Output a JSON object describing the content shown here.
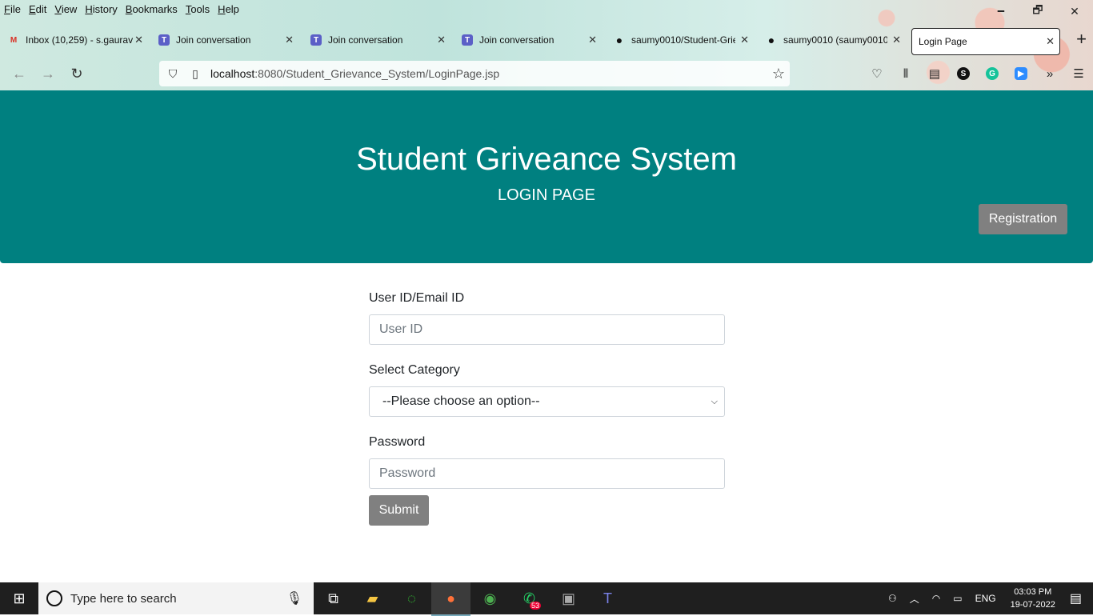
{
  "browser": {
    "menu": [
      "File",
      "Edit",
      "View",
      "History",
      "Bookmarks",
      "Tools",
      "Help"
    ],
    "window_controls": {
      "minimize": "🗕",
      "restore": "🗗",
      "close": "✕"
    },
    "tabs": [
      {
        "label": "Inbox (10,259) - s.gaurav",
        "icon": "gmail-icon",
        "glyph": "M",
        "color": "#d93025"
      },
      {
        "label": "Join conversation",
        "icon": "teams-icon",
        "glyph": "T",
        "color": "#5b5fc7"
      },
      {
        "label": "Join conversation",
        "icon": "teams-icon",
        "glyph": "T",
        "color": "#5b5fc7"
      },
      {
        "label": "Join conversation",
        "icon": "teams-icon",
        "glyph": "T",
        "color": "#5b5fc7"
      },
      {
        "label": "saumy0010/Student-Grie",
        "icon": "github-icon",
        "glyph": "●",
        "color": "#111"
      },
      {
        "label": "saumy0010 (saumy0010",
        "icon": "github-icon",
        "glyph": "●",
        "color": "#111"
      },
      {
        "label": "Login Page",
        "icon": "",
        "glyph": "",
        "color": "#fff"
      }
    ],
    "tab_close": "✕",
    "new_tab": "+",
    "url_host": "localhost",
    "url_path": ":8080/Student_Grievance_System/LoginPage.jsp"
  },
  "page": {
    "title": "Student Griveance System",
    "subtitle": "LOGIN PAGE",
    "registration_button": "Registration",
    "userid_label": "User ID/Email ID",
    "userid_placeholder": "User ID",
    "category_label": "Select Category",
    "category_selected": "--Please choose an option--",
    "password_label": "Password",
    "password_placeholder": "Password",
    "submit_button": "Submit"
  },
  "taskbar": {
    "search_placeholder": "Type here to search",
    "whatsapp_badge": "53",
    "language": "ENG",
    "time": "03:03 PM",
    "date": "19-07-2022"
  },
  "colors": {
    "header": "#008080",
    "button": "#808080"
  }
}
